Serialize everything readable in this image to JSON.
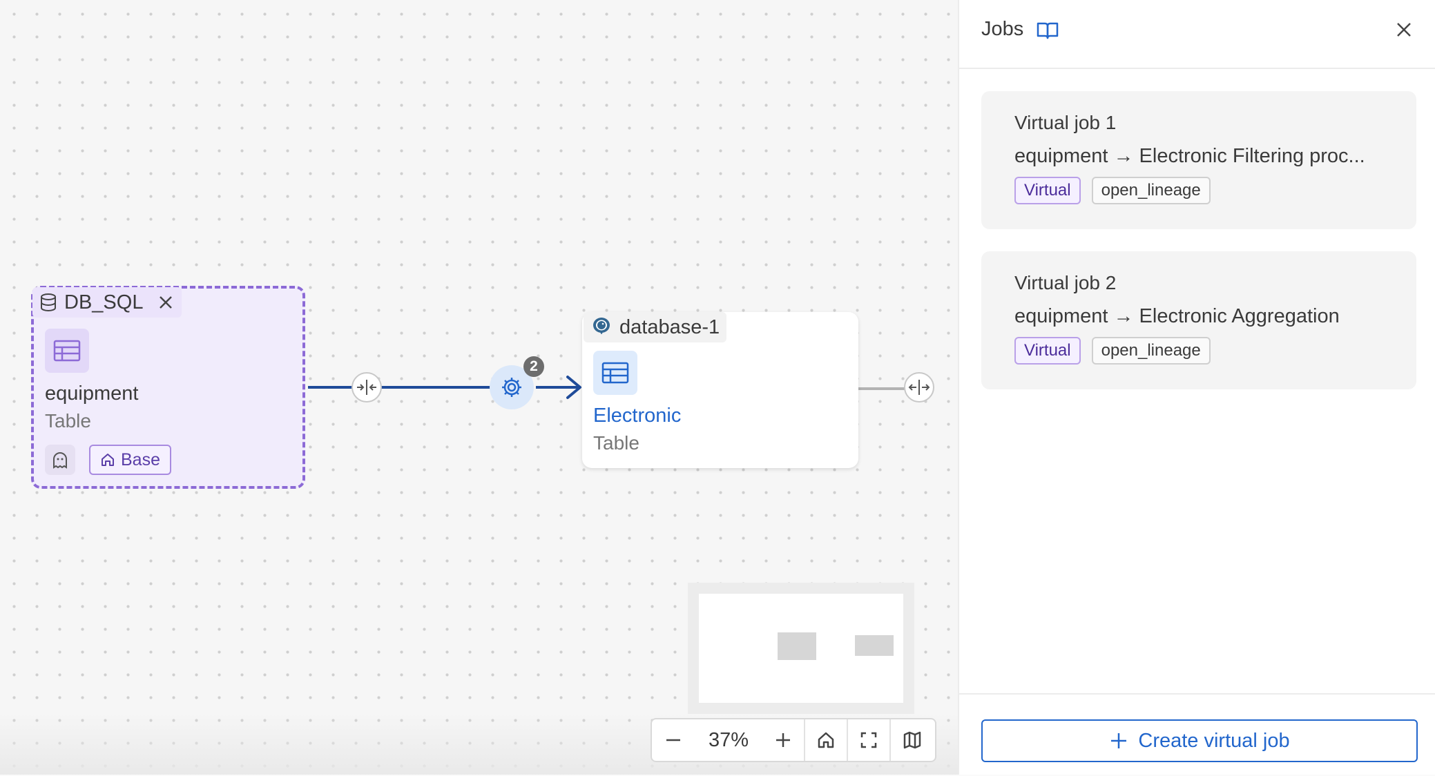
{
  "canvas": {
    "source_node": {
      "group_label": "DB_SQL",
      "name": "equipment",
      "type": "Table",
      "base_label": "Base"
    },
    "target_node": {
      "group_label": "database-1",
      "name": "Electronic",
      "type": "Table"
    },
    "job_count_badge": "2",
    "zoom": {
      "value": "37%"
    }
  },
  "panel": {
    "title": "Jobs",
    "jobs": [
      {
        "name": "Virtual job 1",
        "description": "equipment → Electronic Filtering proc...",
        "tags": [
          "Virtual",
          "open_lineage"
        ]
      },
      {
        "name": "Virtual job 2",
        "description": "equipment → Electronic Aggregation",
        "tags": [
          "Virtual",
          "open_lineage"
        ]
      }
    ],
    "create_label": "Create virtual job"
  },
  "colors": {
    "accent_blue": "#2266cc",
    "edge_blue": "#1f4b99",
    "virtual_purple": "#8c6ad6"
  }
}
